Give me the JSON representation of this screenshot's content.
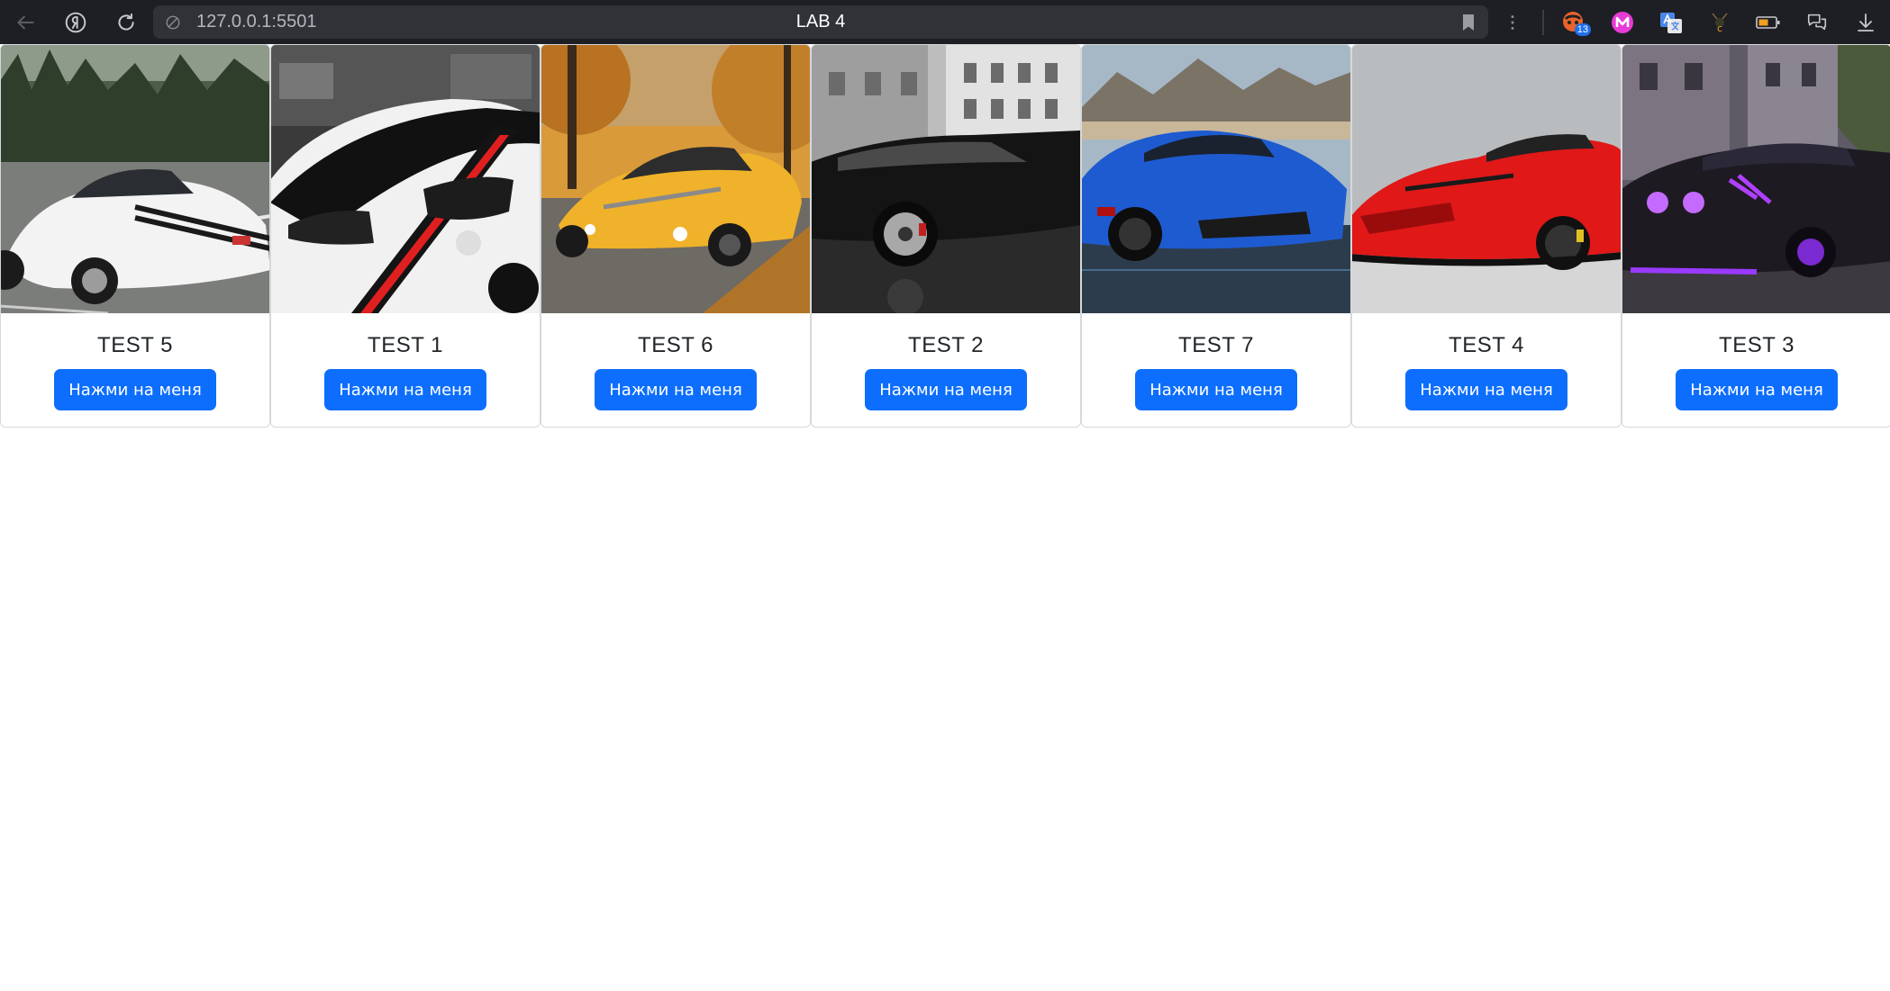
{
  "browser": {
    "url": "127.0.0.1:5501",
    "tab_title": "LAB 4",
    "extension_badge": "13"
  },
  "cards": [
    {
      "title": "TEST 5",
      "button": "Нажми на меня",
      "image": "white sports car on road"
    },
    {
      "title": "TEST 1",
      "button": "Нажми на меня",
      "image": "white car with black and red racing stripes"
    },
    {
      "title": "TEST 6",
      "button": "Нажми на меня",
      "image": "yellow supercar on autumn road"
    },
    {
      "title": "TEST 2",
      "button": "Нажми на меня",
      "image": "black sports car in front of building"
    },
    {
      "title": "TEST 7",
      "button": "Нажми на меня",
      "image": "blue sports car near mountains"
    },
    {
      "title": "TEST 4",
      "button": "Нажми на меня",
      "image": "red sports car"
    },
    {
      "title": "TEST 3",
      "button": "Нажми на меня",
      "image": "dark muscle car with purple lights"
    }
  ],
  "colors": {
    "button": "#0d6efd",
    "chrome": "#1e1f24"
  }
}
